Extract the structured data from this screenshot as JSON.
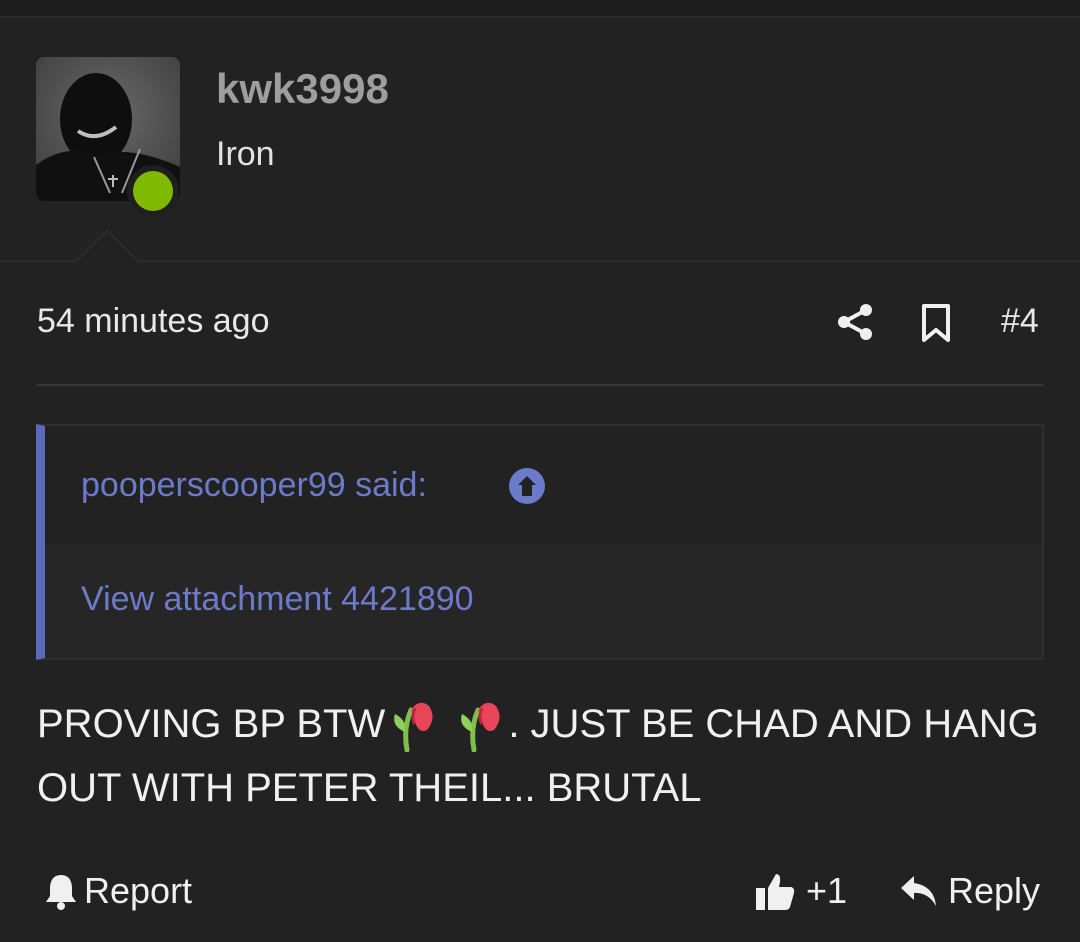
{
  "post": {
    "author": {
      "username": "kwk3998",
      "title": "Iron",
      "online": true,
      "online_color": "#7fba00",
      "avatar_icon": "avatar-photo"
    },
    "timestamp": "54 minutes ago",
    "actions_top": {
      "share_icon": "share-icon",
      "bookmark_icon": "bookmark-icon",
      "post_number": "#4"
    },
    "quote": {
      "author_line": "pooperscooper99 said:",
      "jump_icon": "arrow-up-circle-icon",
      "attachment_text": "View attachment 4421890",
      "accent_color": "#5a69b8"
    },
    "body": {
      "text_before_emoji": "PROVING BP BTW",
      "emoji_names": [
        "wilted-flower-emoji",
        "wilted-flower-emoji"
      ],
      "text_after_emoji": ". JUST BE CHAD AND HANG OUT WITH PETER THEIL... BRUTAL"
    },
    "footer": {
      "report_label": "Report",
      "like_count": "+1",
      "reply_label": "Reply"
    }
  }
}
